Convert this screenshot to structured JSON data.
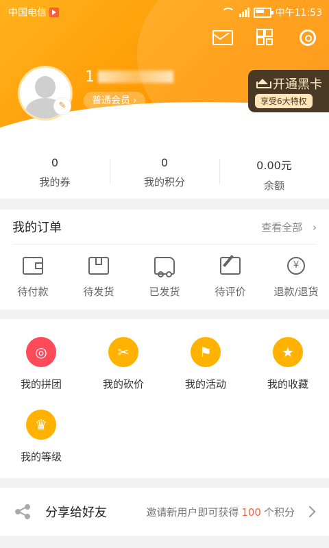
{
  "status_bar": {
    "carrier": "中国电信",
    "time": "中午11:53"
  },
  "header": {
    "username": "1",
    "member_level": "普通会员",
    "vip": {
      "title": "开通黑卡",
      "subtitle": "享受6大特权"
    }
  },
  "stats": [
    {
      "value": "0",
      "label": "我的券"
    },
    {
      "value": "0",
      "label": "我的积分"
    },
    {
      "value": "0.00元",
      "label": "余额"
    }
  ],
  "orders": {
    "title": "我的订单",
    "view_all": "查看全部",
    "items": [
      {
        "label": "待付款",
        "icon": "wallet-icon"
      },
      {
        "label": "待发货",
        "icon": "package-icon"
      },
      {
        "label": "已发货",
        "icon": "truck-icon"
      },
      {
        "label": "待评价",
        "icon": "edit-icon"
      },
      {
        "label": "退款/退货",
        "icon": "refund-icon"
      }
    ]
  },
  "tools": [
    {
      "label": "我的拼团",
      "icon": "badge-icon",
      "color": "#ff4a5a"
    },
    {
      "label": "我的砍价",
      "icon": "tag-icon",
      "color": "#ffb300"
    },
    {
      "label": "我的活动",
      "icon": "flag-icon",
      "color": "#ffb300"
    },
    {
      "label": "我的收藏",
      "icon": "star-icon",
      "color": "#ffb300"
    },
    {
      "label": "我的等级",
      "icon": "crown-icon",
      "color": "#ffb300"
    }
  ],
  "share": {
    "title": "分享给好友",
    "desc_prefix": "邀请新用户即可获得",
    "points": "100",
    "desc_suffix": "个积分"
  },
  "colors": {
    "primary": "#ff9600",
    "vip_bg": "#4a3925",
    "accent_red": "#ff5a3a"
  }
}
